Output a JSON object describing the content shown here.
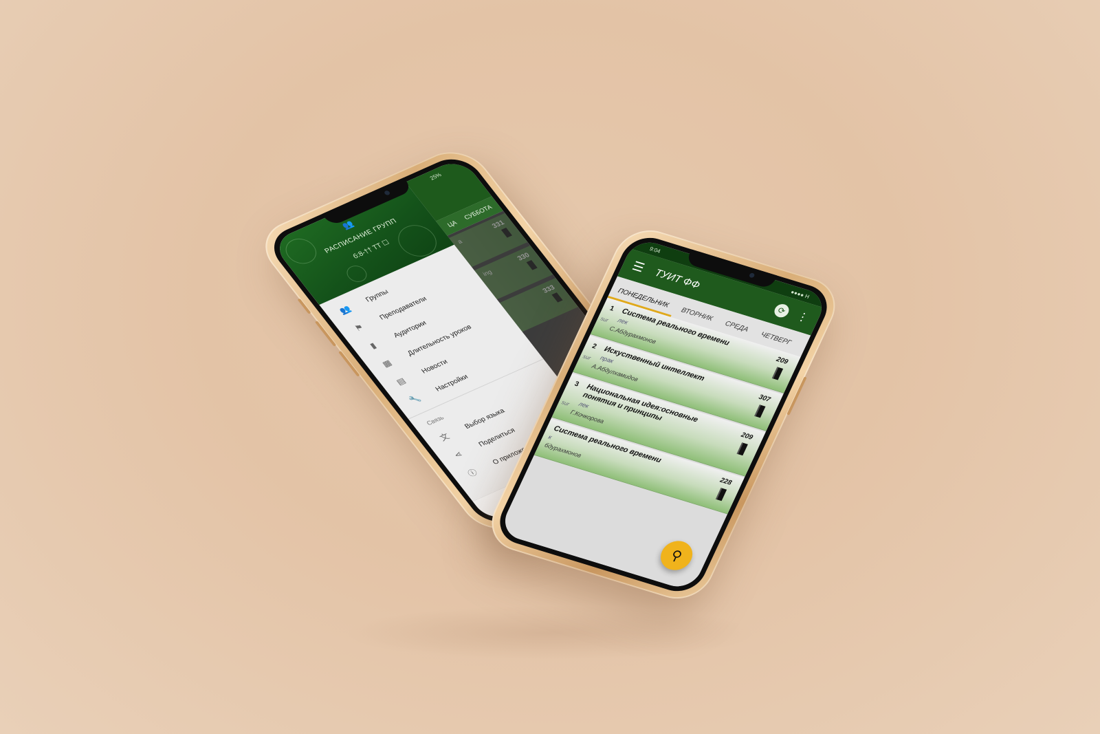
{
  "left_phone": {
    "status": "25%",
    "tabs": [
      "ЦА",
      "СУББОТА"
    ],
    "cards": [
      {
        "text": "а",
        "room": "331"
      },
      {
        "text": "ing",
        "room": "330"
      },
      {
        "text": "",
        "room": "333"
      }
    ],
    "drawer": {
      "header_title": "РАСПИСАНИЕ ГРУПП",
      "header_sub": "б:8-†† ТТ ☐",
      "items": [
        {
          "label": "Группы",
          "icon": "group-icon"
        },
        {
          "label": "Преподаватели",
          "icon": "teacher-icon"
        },
        {
          "label": "Аудитории",
          "icon": "door-icon"
        },
        {
          "label": "Длительность уроков",
          "icon": "calendar-clock-icon"
        },
        {
          "label": "Новости",
          "icon": "news-icon"
        },
        {
          "label": "Настройки",
          "icon": "wrench-icon"
        }
      ],
      "section_label": "Связь",
      "section_items": [
        {
          "label": "Выбор языка",
          "icon": "translate-icon"
        },
        {
          "label": "Поделиться",
          "icon": "share-icon"
        },
        {
          "label": "О приложении",
          "icon": "info-icon"
        }
      ]
    }
  },
  "right_phone": {
    "status_time": "9:04",
    "status_right": "●●●● Н",
    "app_title": "ТУИТ ФФ",
    "tabs": [
      "ПОНЕДЕЛЬНИК",
      "ВТОРНИК",
      "СРЕДА",
      "ЧЕТВЕРГ"
    ],
    "lessons": [
      {
        "num": "1",
        "subject": "Система реального времени",
        "kind": "лек",
        "sur": "sur",
        "teacher": "С.Абдурахмонов",
        "room": "209"
      },
      {
        "num": "2",
        "subject": "Искуственный интеллект",
        "kind": "прак",
        "sur": "sur",
        "teacher": "А.Абдулхамидов",
        "room": "307"
      },
      {
        "num": "3",
        "subject": "Национальная идея:основные понятия и принципы",
        "kind": "лек",
        "sur": "sur",
        "teacher": "Г.Кочкорова",
        "room": "209"
      },
      {
        "num": "",
        "subject": "Система реального времени",
        "kind": "к",
        "sur": "",
        "teacher": "бдурахмонов",
        "room": "228"
      }
    ]
  },
  "colors": {
    "app_green": "#1f5a1d",
    "accent": "#f0b31c",
    "background": "#e3c3a6"
  }
}
